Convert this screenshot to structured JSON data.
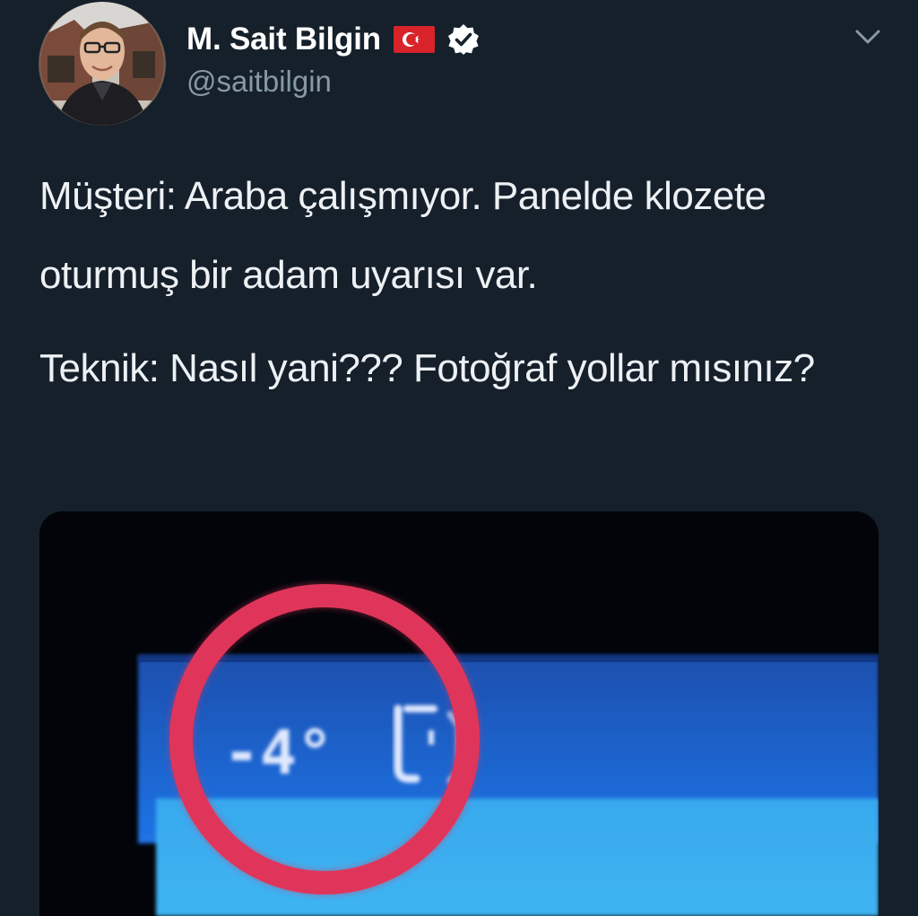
{
  "tweet": {
    "author": {
      "display_name": "M. Sait Bilgin",
      "handle": "@saitbilgin",
      "flag_icon": "turkey-flag-icon",
      "verified_icon": "verified-badge-icon",
      "verified_color": "#ffffff"
    },
    "menu_icon": "chevron-down-icon",
    "text": {
      "paragraph_1": "Müşteri: Araba çalışmıyor. Panelde klozete oturmuş bir adam uyarısı var.",
      "paragraph_2": "Teknik: Nasıl yani??? Fotoğraf yollar mısınız?"
    },
    "media": {
      "display_reading": "-4°",
      "highlight_color": "#e0355a"
    }
  },
  "colors": {
    "background": "#15202b",
    "secondary_text": "#8899a6",
    "panel_blue": "#1f6fe0"
  }
}
